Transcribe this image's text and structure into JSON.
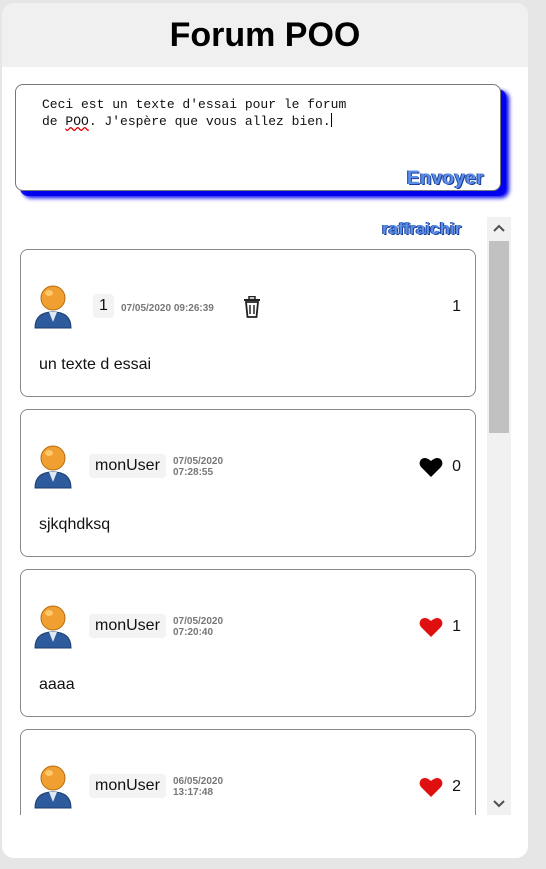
{
  "app": {
    "title": "Forum POO"
  },
  "composer": {
    "line1": "Ceci est un texte d'essai pour le forum",
    "line2_pre": "de ",
    "line2_flag": "POO",
    "line2_post": ". J'espère que vous allez bien.",
    "send_label": "Envoyer"
  },
  "refresh_label": "raffraichir",
  "posts": [
    {
      "user": "1",
      "date": "07/05/2020 09:26:39",
      "date_day": "07/05/2020",
      "date_time": "09:26:39",
      "likes": "1",
      "liked": "own",
      "content": "un texte d essai"
    },
    {
      "user": "monUser",
      "date_day": "07/05/2020",
      "date_time": "07:28:55",
      "likes": "0",
      "liked": "no",
      "content": "sjkqhdksq"
    },
    {
      "user": "monUser",
      "date_day": "07/05/2020",
      "date_time": "07:20:40",
      "likes": "1",
      "liked": "yes",
      "content": "aaaa"
    },
    {
      "user": "monUser",
      "date_day": "06/05/2020",
      "date_time": "13:17:48",
      "likes": "2",
      "liked": "yes",
      "content": ""
    }
  ],
  "colors": {
    "like_active": "#e01010",
    "like_inactive": "#000000",
    "accent": "#5b8ee6",
    "shadow": "#0000ee"
  },
  "icons": {
    "avatar": "user-avatar-icon",
    "trash": "trash-icon",
    "heart": "heart-icon",
    "scroll_up": "chevron-up-icon",
    "scroll_down": "chevron-down-icon"
  }
}
